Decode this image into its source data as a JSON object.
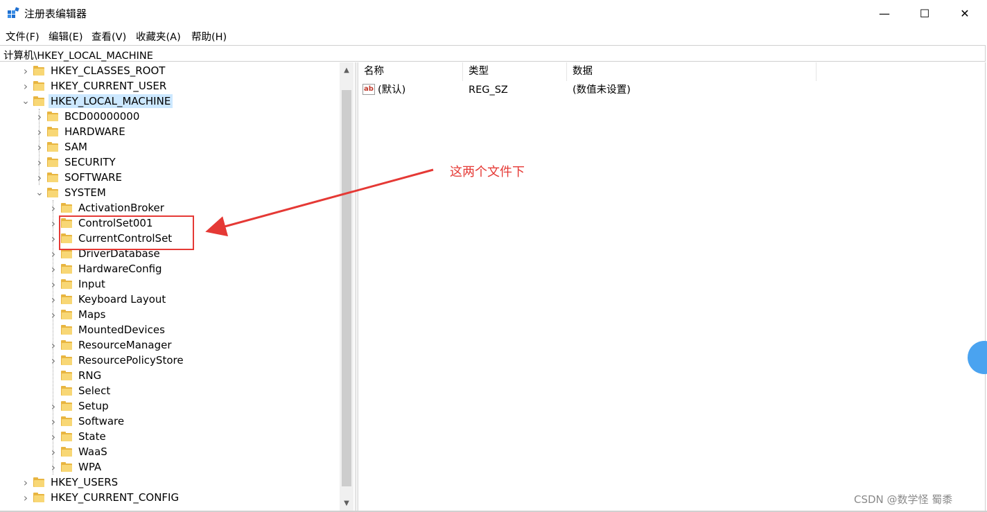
{
  "window": {
    "title": "注册表编辑器",
    "minimize_glyph": "—",
    "maximize_glyph": "☐",
    "close_glyph": "✕"
  },
  "menu": [
    "文件(F)",
    "编辑(E)",
    "查看(V)",
    "收藏夹(A)",
    "帮助(H)"
  ],
  "address": "计算机\\HKEY_LOCAL_MACHINE",
  "tree": [
    {
      "label": "HKEY_CLASSES_ROOT",
      "level": 0,
      "expander": "collapsed"
    },
    {
      "label": "HKEY_CURRENT_USER",
      "level": 0,
      "expander": "collapsed"
    },
    {
      "label": "HKEY_LOCAL_MACHINE",
      "level": 0,
      "expander": "expanded",
      "selected": true
    },
    {
      "label": "BCD00000000",
      "level": 1,
      "expander": "collapsed"
    },
    {
      "label": "HARDWARE",
      "level": 1,
      "expander": "collapsed"
    },
    {
      "label": "SAM",
      "level": 1,
      "expander": "collapsed"
    },
    {
      "label": "SECURITY",
      "level": 1,
      "expander": "collapsed"
    },
    {
      "label": "SOFTWARE",
      "level": 1,
      "expander": "collapsed"
    },
    {
      "label": "SYSTEM",
      "level": 1,
      "expander": "expanded"
    },
    {
      "label": "ActivationBroker",
      "level": 2,
      "expander": "collapsed"
    },
    {
      "label": "ControlSet001",
      "level": 2,
      "expander": "collapsed"
    },
    {
      "label": "CurrentControlSet",
      "level": 2,
      "expander": "collapsed"
    },
    {
      "label": "DriverDatabase",
      "level": 2,
      "expander": "collapsed"
    },
    {
      "label": "HardwareConfig",
      "level": 2,
      "expander": "collapsed"
    },
    {
      "label": "Input",
      "level": 2,
      "expander": "collapsed"
    },
    {
      "label": "Keyboard Layout",
      "level": 2,
      "expander": "collapsed"
    },
    {
      "label": "Maps",
      "level": 2,
      "expander": "collapsed"
    },
    {
      "label": "MountedDevices",
      "level": 2,
      "expander": "none"
    },
    {
      "label": "ResourceManager",
      "level": 2,
      "expander": "collapsed"
    },
    {
      "label": "ResourcePolicyStore",
      "level": 2,
      "expander": "collapsed"
    },
    {
      "label": "RNG",
      "level": 2,
      "expander": "none"
    },
    {
      "label": "Select",
      "level": 2,
      "expander": "none"
    },
    {
      "label": "Setup",
      "level": 2,
      "expander": "collapsed"
    },
    {
      "label": "Software",
      "level": 2,
      "expander": "collapsed"
    },
    {
      "label": "State",
      "level": 2,
      "expander": "collapsed"
    },
    {
      "label": "WaaS",
      "level": 2,
      "expander": "collapsed"
    },
    {
      "label": "WPA",
      "level": 2,
      "expander": "collapsed"
    },
    {
      "label": "HKEY_USERS",
      "level": 0,
      "expander": "collapsed"
    },
    {
      "label": "HKEY_CURRENT_CONFIG",
      "level": 0,
      "expander": "collapsed"
    }
  ],
  "list": {
    "columns": [
      "名称",
      "类型",
      "数据"
    ],
    "rows": [
      {
        "name": "(默认)",
        "type": "REG_SZ",
        "data": "(数值未设置)",
        "icon": "string-value-icon"
      }
    ]
  },
  "annotation": {
    "text": "这两个文件下",
    "color": "#e53935"
  },
  "watermark": "CSDN @数学怪 蜀黍",
  "colors": {
    "selection": "#cce8ff",
    "folder": "#f8d775",
    "annotation_red": "#e53935"
  }
}
